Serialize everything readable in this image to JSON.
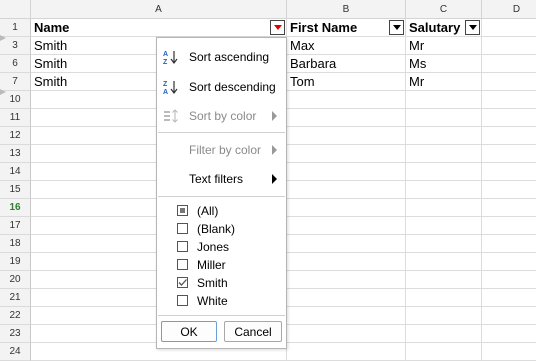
{
  "columns": [
    "A",
    "B",
    "C",
    "D"
  ],
  "rows": [
    {
      "num": "1",
      "cells": [
        "Name",
        "First Name",
        "Salutary",
        ""
      ],
      "header": true
    },
    {
      "num": "3",
      "cells": [
        "Smith",
        "Max",
        "Mr",
        ""
      ]
    },
    {
      "num": "6",
      "cells": [
        "Smith",
        "Barbara",
        "Ms",
        ""
      ]
    },
    {
      "num": "7",
      "cells": [
        "Smith",
        "Tom",
        "Mr",
        ""
      ]
    },
    {
      "num": "10",
      "cells": [
        "",
        "",
        "",
        ""
      ]
    },
    {
      "num": "11",
      "cells": [
        "",
        "",
        "",
        ""
      ]
    },
    {
      "num": "12",
      "cells": [
        "",
        "",
        "",
        ""
      ]
    },
    {
      "num": "13",
      "cells": [
        "",
        "",
        "",
        ""
      ]
    },
    {
      "num": "14",
      "cells": [
        "",
        "",
        "",
        ""
      ]
    },
    {
      "num": "15",
      "cells": [
        "",
        "",
        "",
        ""
      ]
    },
    {
      "num": "16",
      "cells": [
        "",
        "",
        "",
        ""
      ],
      "active": true
    },
    {
      "num": "17",
      "cells": [
        "",
        "",
        "",
        ""
      ]
    },
    {
      "num": "18",
      "cells": [
        "",
        "",
        "",
        ""
      ]
    },
    {
      "num": "19",
      "cells": [
        "",
        "",
        "",
        ""
      ]
    },
    {
      "num": "20",
      "cells": [
        "",
        "",
        "",
        ""
      ]
    },
    {
      "num": "21",
      "cells": [
        "",
        "",
        "",
        ""
      ]
    },
    {
      "num": "22",
      "cells": [
        "",
        "",
        "",
        ""
      ]
    },
    {
      "num": "23",
      "cells": [
        "",
        "",
        "",
        ""
      ]
    },
    {
      "num": "24",
      "cells": [
        "",
        "",
        "",
        ""
      ]
    }
  ],
  "menu": {
    "sort_ascending": "Sort ascending",
    "sort_descending": "Sort descending",
    "sort_by_color": "Sort by color",
    "filter_by_color": "Filter by color",
    "text_filters": "Text filters",
    "values": [
      {
        "label": "(All)",
        "state": "indeterminate"
      },
      {
        "label": "(Blank)",
        "state": "unchecked"
      },
      {
        "label": "Jones",
        "state": "unchecked"
      },
      {
        "label": "Miller",
        "state": "unchecked"
      },
      {
        "label": "Smith",
        "state": "checked"
      },
      {
        "label": "White",
        "state": "unchecked"
      }
    ],
    "ok_label": "OK",
    "cancel_label": "Cancel"
  },
  "colors": {
    "active_filter": "#e00000",
    "active_row": "#2e7d32",
    "header_bg": "#f3f3f3"
  }
}
